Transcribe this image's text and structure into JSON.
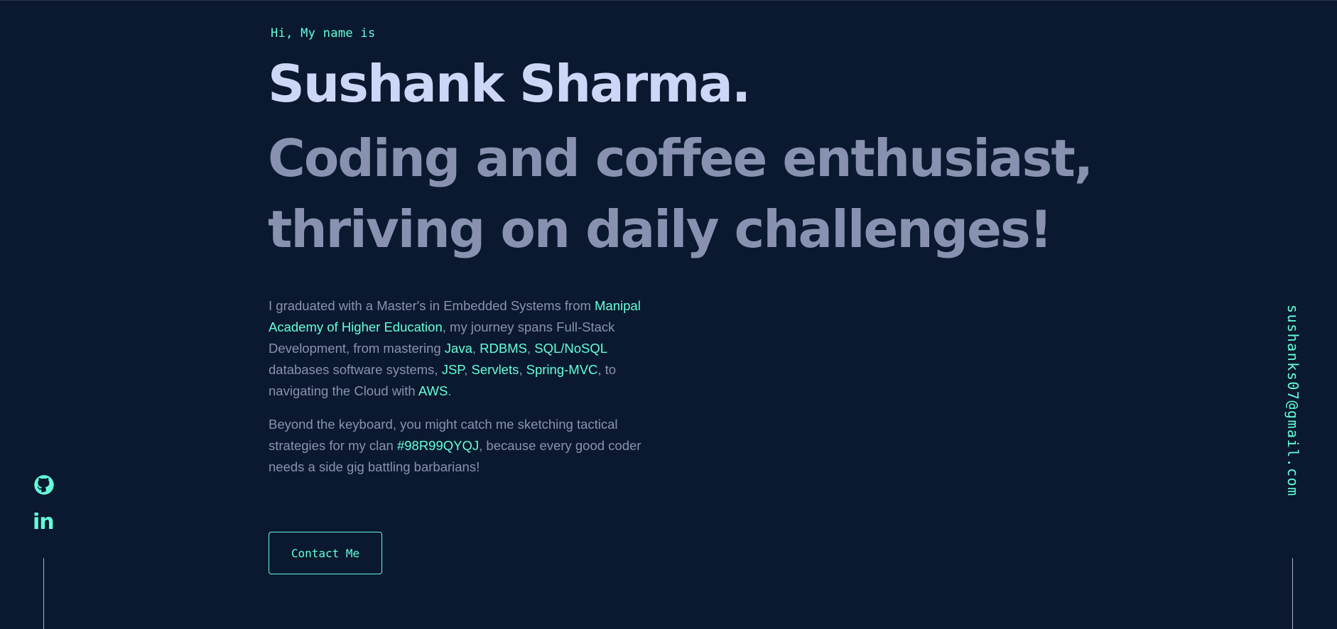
{
  "hero": {
    "greeting": "Hi, My name is",
    "name": "Sushank Sharma.",
    "tagline_line1": "Coding and coffee enthusiast,",
    "tagline_line2": "thriving on daily challenges!"
  },
  "about": {
    "p1": {
      "t1": "I graduated with a Master's in Embedded Systems from ",
      "university": "Manipal Academy of Higher Education",
      "t2": ", my journey spans Full-Stack Development, from mastering ",
      "java": "Java",
      "sep1": ", ",
      "rdbms": "RDBMS",
      "sep2": ", ",
      "sql": "SQL/NoSQL",
      "t3": " databases software systems, ",
      "jsp": "JSP",
      "sep3": ", ",
      "servlets": "Servlets",
      "sep4": ", ",
      "spring": "Spring-MVC",
      "t4": ", to navigating the Cloud with ",
      "aws": "AWS",
      "t5": "."
    },
    "p2": {
      "t1": "Beyond the keyboard, you might catch me sketching tactical strategies for my clan ",
      "clan": "#98R99QYQJ",
      "t2": ", because every good coder needs a side gig battling barbarians!"
    }
  },
  "actions": {
    "contact_label": "Contact Me"
  },
  "social": {
    "github_icon": "github-icon",
    "linkedin_label": "in"
  },
  "email": "sushanks07@gmail.com",
  "colors": {
    "background": "#0a192f",
    "accent": "#64ffda",
    "heading": "#ccd6f6",
    "text": "#8892b0"
  }
}
